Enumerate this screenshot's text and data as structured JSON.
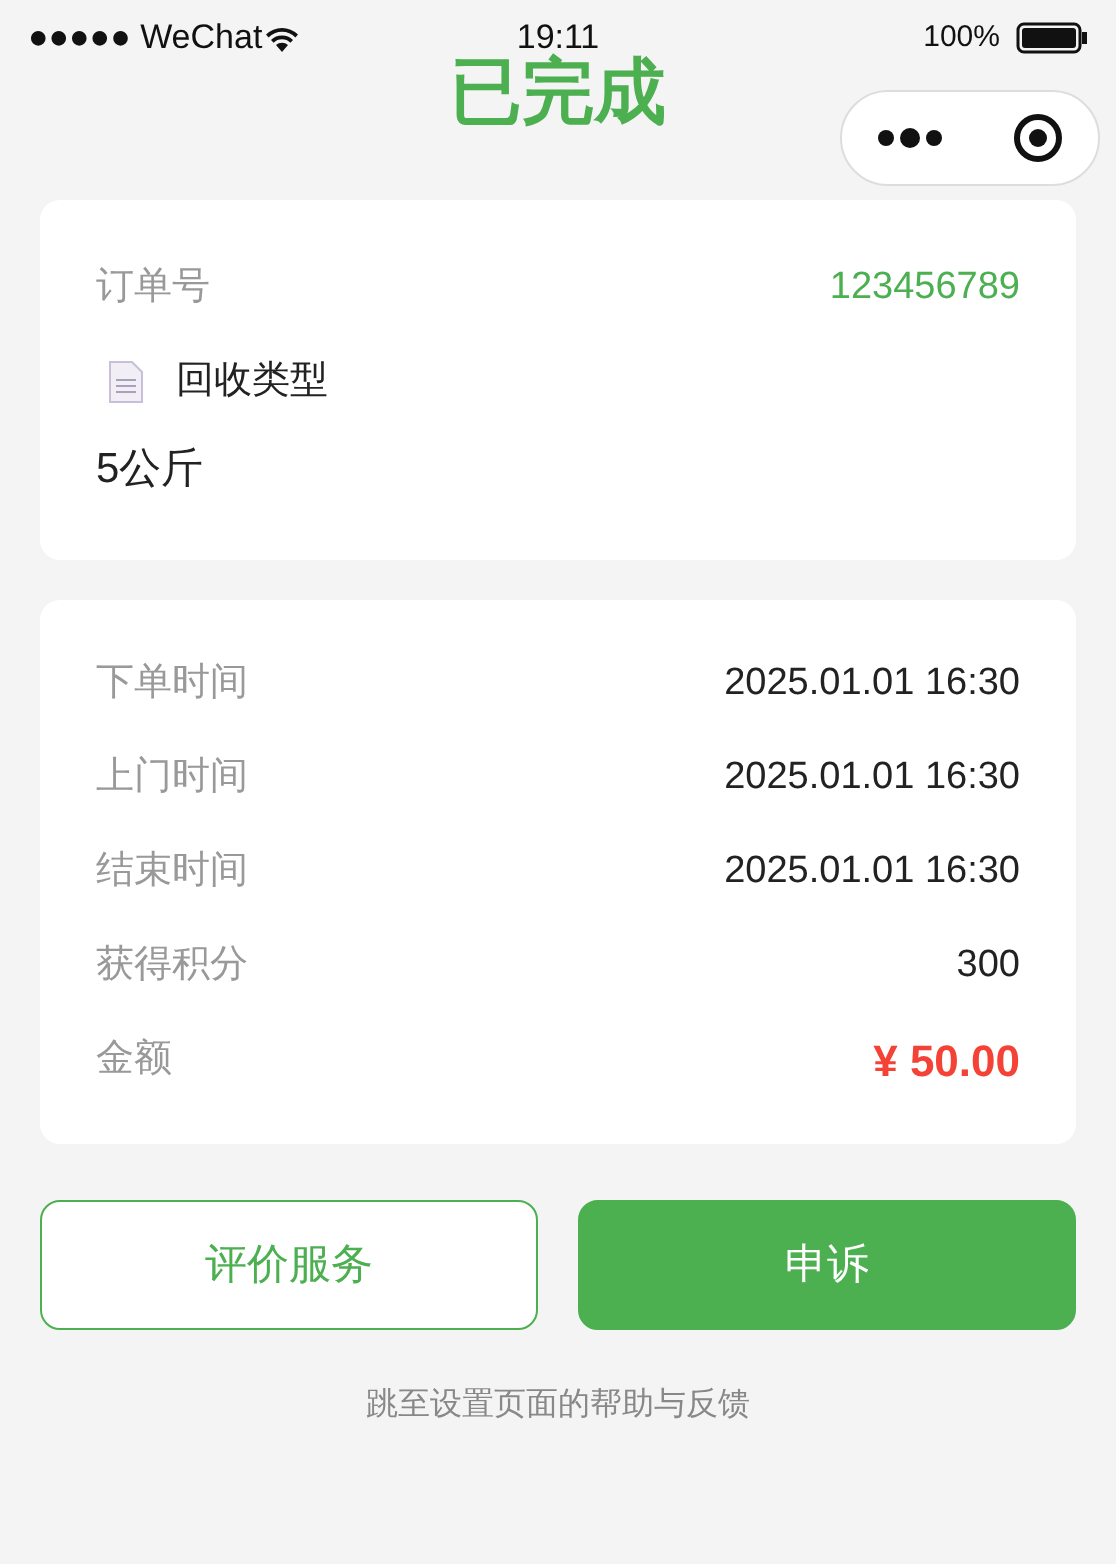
{
  "status_bar": {
    "carrier": "●●●●● WeChat",
    "time": "19:11",
    "battery": "100%"
  },
  "title": "已完成",
  "order": {
    "number_label": "订单号",
    "number": "123456789",
    "type_label": "回收类型",
    "weight": "5公斤"
  },
  "details": [
    {
      "label": "下单时间",
      "value": "2025.01.01 16:30",
      "kind": "plain"
    },
    {
      "label": "上门时间",
      "value": "2025.01.01 16:30",
      "kind": "plain"
    },
    {
      "label": "结束时间",
      "value": "2025.01.01 16:30",
      "kind": "plain"
    },
    {
      "label": "获得积分",
      "value": "300",
      "kind": "plain"
    },
    {
      "label": "金额",
      "value": "¥ 50.00",
      "kind": "money"
    }
  ],
  "buttons": [
    {
      "label": "评价服务",
      "kind": "outline"
    },
    {
      "label": "申诉",
      "kind": "filled"
    }
  ],
  "footer_link": "跳至设置页面的帮助与反馈"
}
